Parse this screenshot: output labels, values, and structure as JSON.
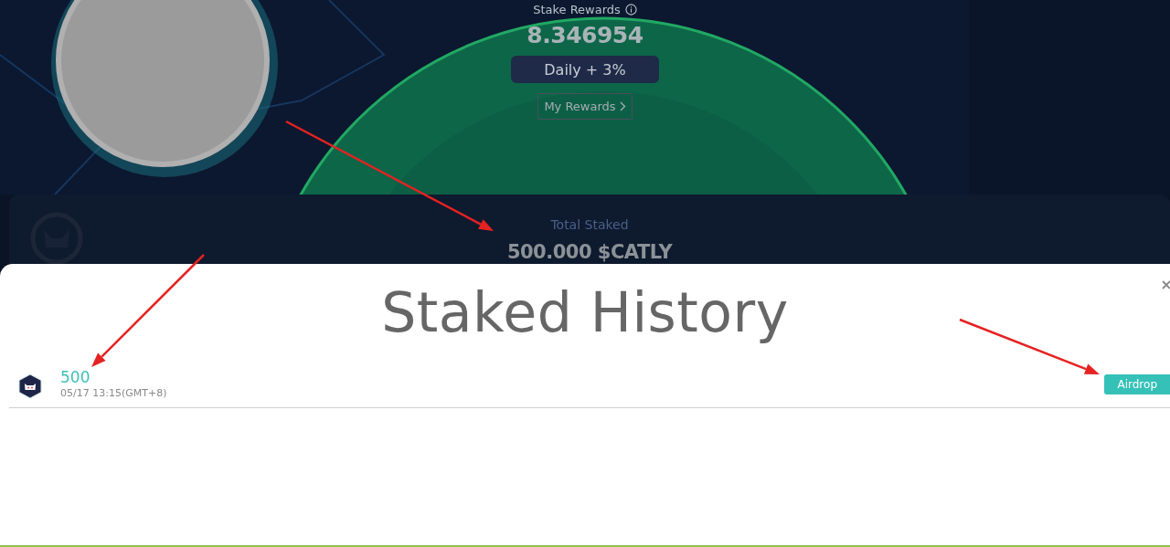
{
  "hero": {
    "title": "Stake Rewards",
    "amount": "8.346954",
    "rate": "Daily + 3%",
    "button": "My Rewards"
  },
  "total": {
    "label": "Total Staked",
    "amount": "500.000 $CATLY"
  },
  "modal": {
    "title": "Staked History",
    "rows": [
      {
        "amount": "500",
        "time": "05/17 13:15(GMT+8)",
        "tag": "Airdrop"
      }
    ]
  }
}
